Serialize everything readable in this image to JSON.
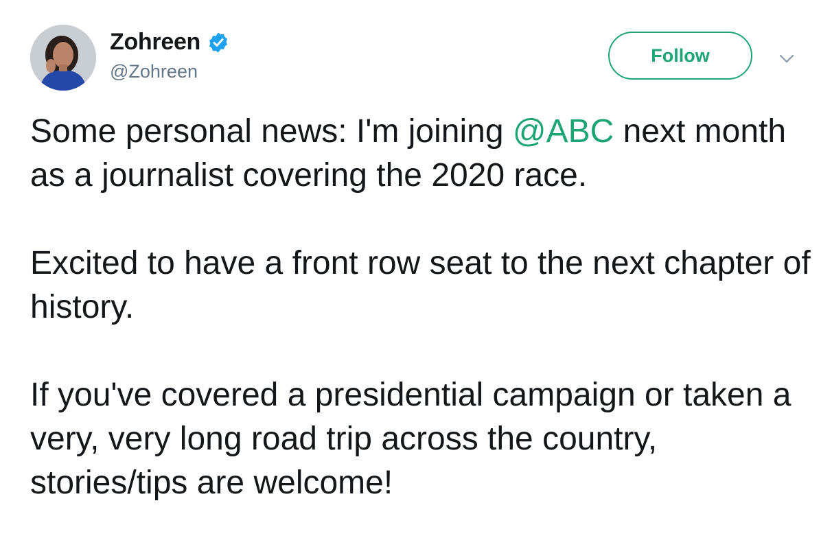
{
  "user": {
    "display_name": "Zohreen",
    "handle": "@Zohreen",
    "verified": true
  },
  "actions": {
    "follow_label": "Follow"
  },
  "tweet": {
    "para1_before": "Some personal news: I'm joining ",
    "para1_mention": "@ABC",
    "para1_after": " next month as a journalist covering the 2020 race.",
    "para2": "Excited to have a front row seat to the next chapter of history.",
    "para3": "If you've covered a presidential campaign or taken a very, very long road trip across the country, stories/tips are welcome!"
  },
  "colors": {
    "accent": "#1da673",
    "verified": "#1da1f2",
    "text": "#14171a",
    "secondary": "#657786"
  },
  "icons": {
    "verified": "verified-badge-icon",
    "caret": "chevron-down-icon",
    "avatar": "profile-photo"
  }
}
